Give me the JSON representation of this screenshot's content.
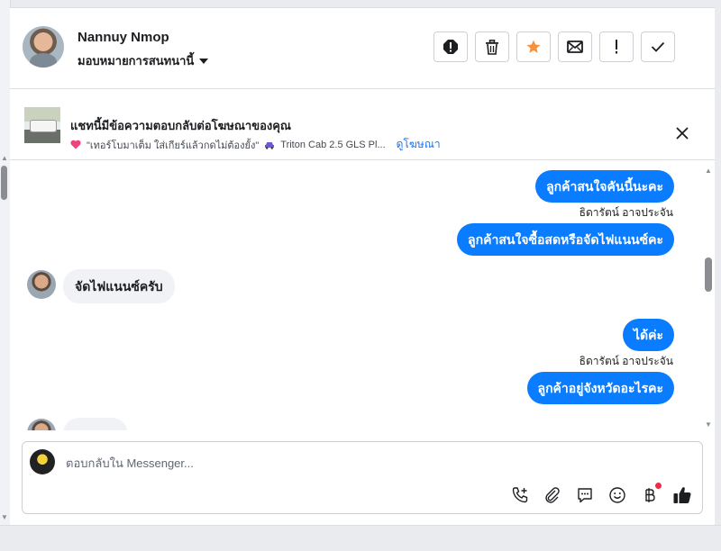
{
  "header": {
    "contact_name": "Nannuy Nmop",
    "assign_label": "มอบหมายการสนทนานี้"
  },
  "ad": {
    "title": "แชทนี้มีข้อความตอบกลับต่อโฆษณาของคุณ",
    "quote": "\"เทอร์โบมาเต็ม ใส่เกียร์แล้วกดไม่ต้องยั้ง\"",
    "vehicle": "Triton Cab 2.5 GLS Pl...",
    "view_ad_link": "ดูโฆษณา"
  },
  "messages": [
    {
      "direction": "out",
      "text": "ลูกค้าสนใจคันนี้นะคะ"
    },
    {
      "direction": "note",
      "text": "ธิดารัตน์ อาจประจัน"
    },
    {
      "direction": "out",
      "text": "ลูกค้าสนใจซื้อสดหรือจัดไฟแนนซ์คะ"
    },
    {
      "direction": "in",
      "text": "จัดไฟแนนซ์ครับ"
    },
    {
      "direction": "out",
      "text": "ได้ค่ะ"
    },
    {
      "direction": "note",
      "text": "ธิดารัตน์ อาจประจัน"
    },
    {
      "direction": "out",
      "text": "ลูกค้าอยู่จังหวัดอะไรคะ"
    }
  ],
  "composer": {
    "placeholder": "ตอบกลับใน Messenger..."
  },
  "icons": {
    "header_actions": [
      "report-icon",
      "trash-icon",
      "star-icon",
      "envelope-icon",
      "exclamation-icon",
      "checkmark-icon"
    ],
    "composer_tools": [
      "phone-plus-icon",
      "paperclip-icon",
      "chat-bubble-icon",
      "smiley-icon",
      "baht-icon",
      "thumbs-up-icon"
    ]
  },
  "colors": {
    "accent": "#0a7cff",
    "star": "#f7923b",
    "notification_dot": "#f02849",
    "incoming_bubble": "#f0f2f5"
  }
}
